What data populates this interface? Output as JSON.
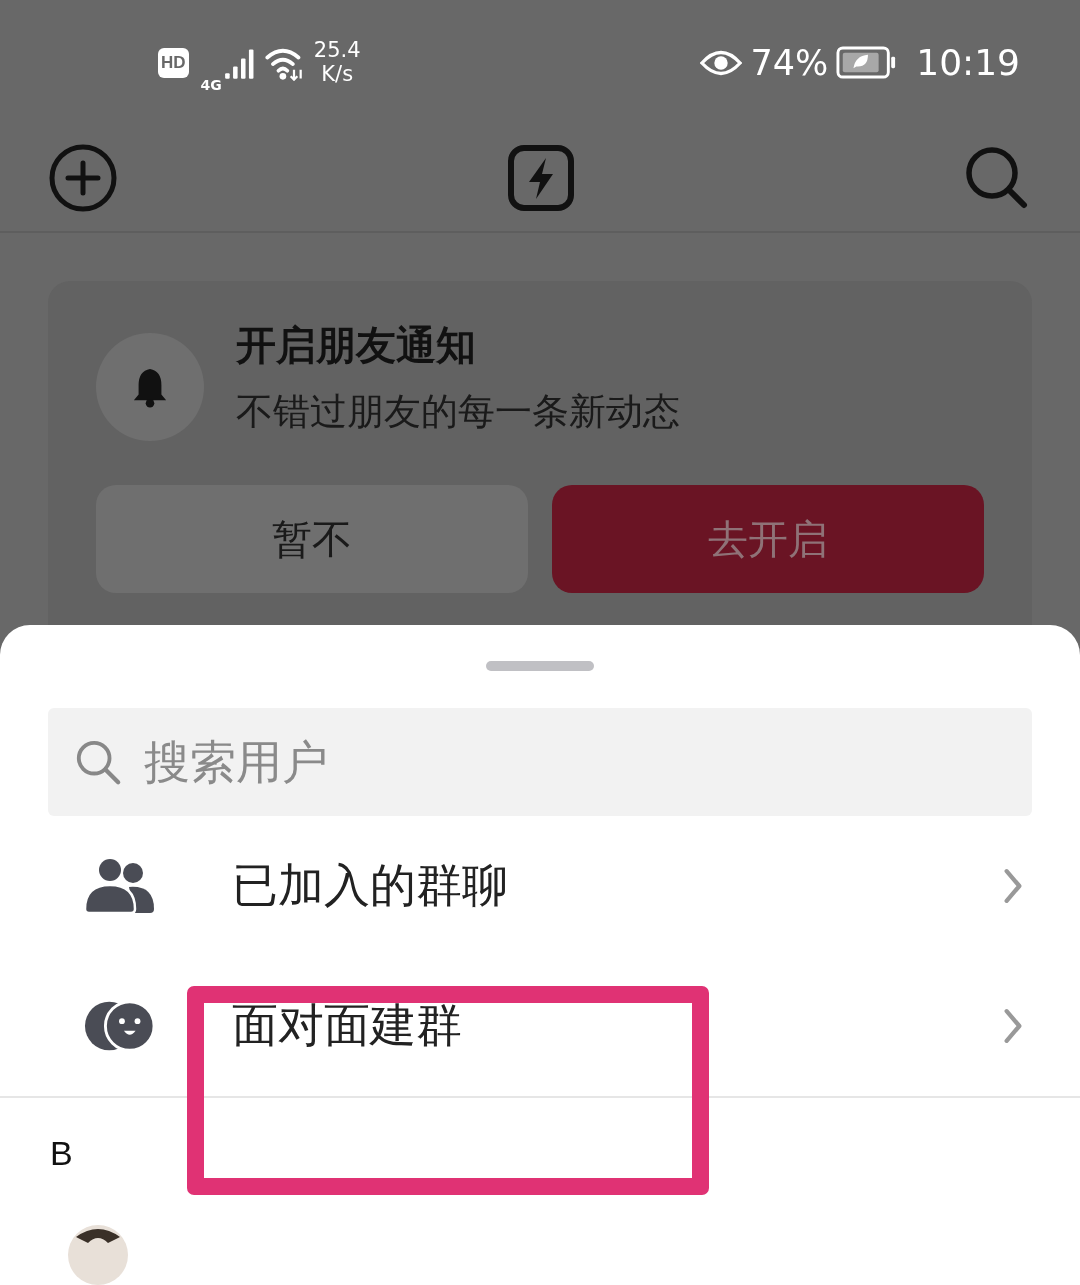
{
  "status_bar": {
    "hd_badge": "HD",
    "network_type": "4G",
    "network_speed": "25.4",
    "speed_unit": "K/s",
    "battery": "74%",
    "time": "10:19"
  },
  "notification_card": {
    "title": "开启朋友通知",
    "subtitle": "不错过朋友的每一条新动态",
    "buttons": [
      {
        "label": "暂不",
        "kind": "secondary"
      },
      {
        "label": "去开启",
        "kind": "primary"
      }
    ]
  },
  "sheet": {
    "search": {
      "placeholder": "搜索用户"
    },
    "items": [
      {
        "label": "已加入的群聊",
        "kind": "groups"
      },
      {
        "label": "面对面建群",
        "kind": "face"
      }
    ],
    "section_header": "B"
  }
}
